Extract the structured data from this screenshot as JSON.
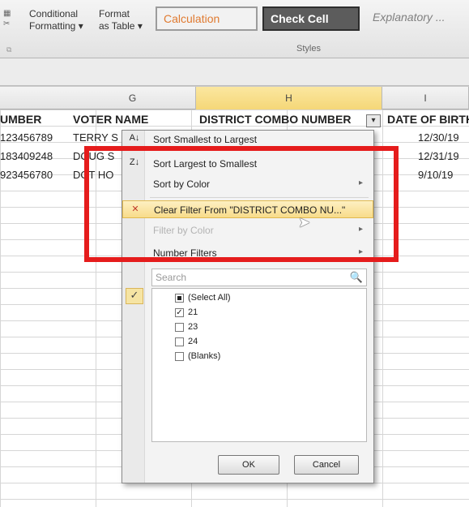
{
  "ribbon": {
    "conditional_formatting": "Conditional",
    "conditional_formatting_2": "Formatting",
    "format_as_table": "Format",
    "format_as_table_2": "as Table",
    "style_calculation": "Calculation",
    "style_check_cell": "Check Cell",
    "style_explanatory": "Explanatory ...",
    "styles_group_label": "Styles"
  },
  "columns": {
    "g": "G",
    "h": "H",
    "i": "I"
  },
  "headers": {
    "number": "UMBER",
    "voter_name": "VOTER NAME",
    "district_combo": "DISTRICT COMBO NUMBER",
    "dob": "DATE OF BIRTH"
  },
  "rows": [
    {
      "number": "123456789",
      "voter": "TERRY S",
      "dob": "12/30/19"
    },
    {
      "number": "183409248",
      "voter": "DOUG S",
      "dob": "12/31/19"
    },
    {
      "number": "923456780",
      "voter": "DOT HO",
      "dob": "9/10/19"
    }
  ],
  "menu": {
    "sort_asc": "Sort Smallest to Largest",
    "sort_desc": "Sort Largest to Smallest",
    "sort_color": "Sort by Color",
    "clear_filter": "Clear Filter From \"DISTRICT COMBO NU...\"",
    "filter_color": "Filter by Color",
    "number_filters": "Number Filters",
    "search_placeholder": "Search",
    "list_items": [
      {
        "label": "(Select All)",
        "state": "partial"
      },
      {
        "label": "21",
        "state": "checked"
      },
      {
        "label": "23",
        "state": "unchecked"
      },
      {
        "label": "24",
        "state": "unchecked"
      },
      {
        "label": "(Blanks)",
        "state": "unchecked"
      }
    ],
    "ok": "OK",
    "cancel": "Cancel"
  },
  "colors": {
    "highlight_box": "#e51c1c",
    "active_column": "#f5d778"
  }
}
